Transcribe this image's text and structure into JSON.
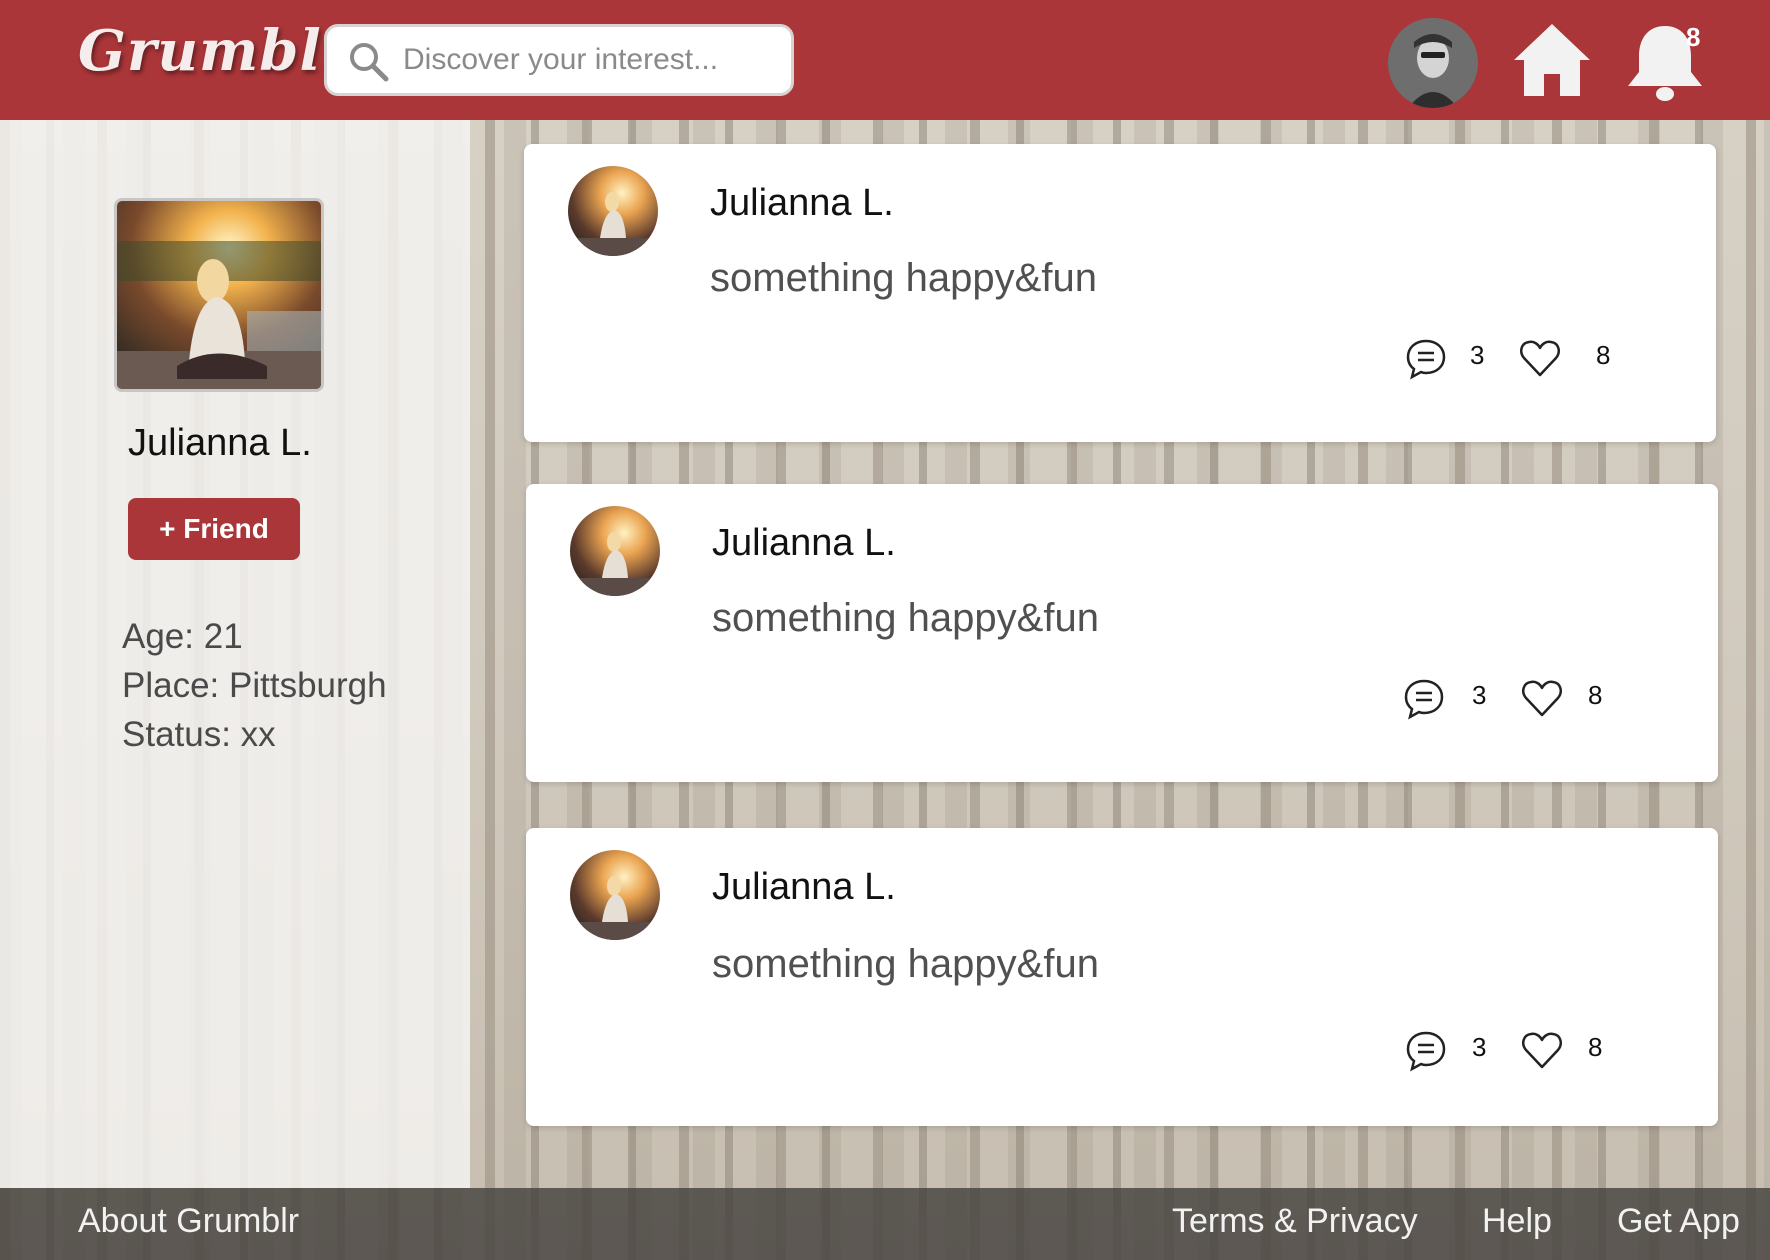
{
  "app": {
    "logo_text": "Grumblr",
    "brand_color": "#ab3639"
  },
  "header": {
    "search": {
      "placeholder": "Discover your interest...",
      "value": ""
    },
    "notifications": {
      "count": "8"
    },
    "icons": [
      "search-icon",
      "user-avatar",
      "home-icon",
      "bell-icon"
    ]
  },
  "profile": {
    "name": "Julianna L.",
    "friend_button_label": "+ Friend",
    "info": [
      "Age: 21",
      "Place: Pittsburgh",
      "Status: xx"
    ]
  },
  "posts": [
    {
      "author": "Julianna L.",
      "text": "something happy&fun",
      "comments": "3",
      "likes": "8"
    },
    {
      "author": "Julianna L.",
      "text": "something happy&fun",
      "comments": "3",
      "likes": "8"
    },
    {
      "author": "Julianna L.",
      "text": "something happy&fun",
      "comments": "3",
      "likes": "8"
    }
  ],
  "footer": {
    "about": "About Grumblr",
    "terms": "Terms & Privacy",
    "help": "Help",
    "get_app": "Get App"
  }
}
